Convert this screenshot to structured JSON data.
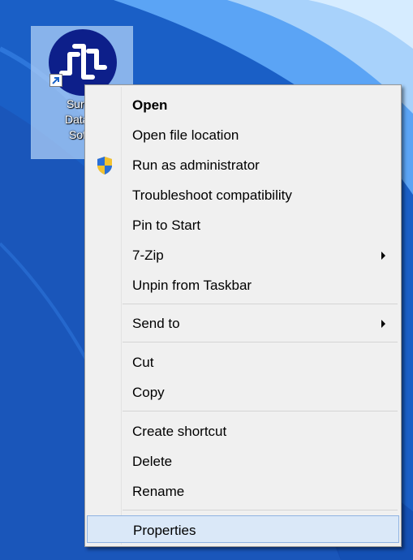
{
  "desktop": {
    "colors": {
      "background": "#1a5fc6",
      "accent": "#6fb1ff",
      "sky": "#c8e3ff"
    },
    "icon": {
      "label_lines": [
        "SureT",
        "Data A",
        "Softv"
      ],
      "logo_icon": "suretrack-logo-icon",
      "overlay_icon": "shortcut-arrow-icon"
    }
  },
  "context_menu": {
    "items": [
      {
        "label": "Open",
        "bold": true
      },
      {
        "label": "Open file location"
      },
      {
        "label": "Run as administrator",
        "icon": "uac-shield-icon"
      },
      {
        "label": "Troubleshoot compatibility"
      },
      {
        "label": "Pin to Start"
      },
      {
        "label": "7-Zip",
        "submenu": true
      },
      {
        "label": "Unpin from Taskbar"
      },
      {
        "label": "Send to",
        "submenu": true
      },
      {
        "label": "Cut"
      },
      {
        "label": "Copy"
      },
      {
        "label": "Create shortcut"
      },
      {
        "label": "Delete"
      },
      {
        "label": "Rename"
      },
      {
        "label": "Properties",
        "highlighted": true
      }
    ]
  }
}
